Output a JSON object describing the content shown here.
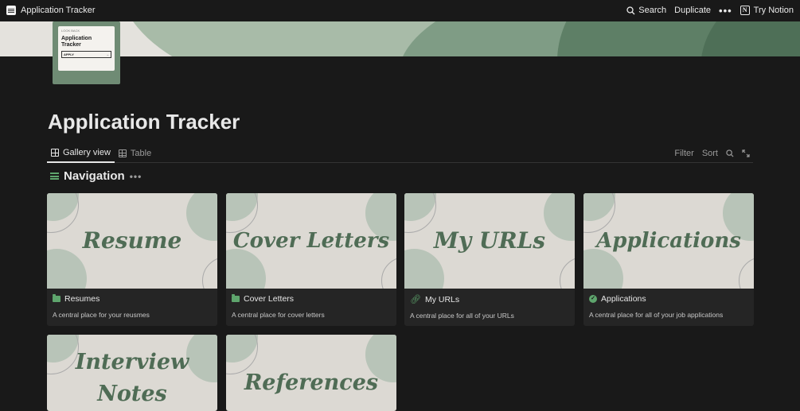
{
  "topbar": {
    "title": "Application Tracker",
    "search": "Search",
    "duplicate": "Duplicate",
    "more": "•••",
    "try_notion": "Try Notion",
    "notion_logo": "N"
  },
  "icon_card": {
    "tiny_text": "LOOK BACK",
    "title_line1": "Application",
    "title_line2": "Tracker",
    "apply": "APPLY",
    "apply_arrow": "→"
  },
  "page": {
    "title": "Application Tracker"
  },
  "tabs": [
    {
      "label": "Gallery view",
      "icon": "gallery-icon",
      "active": true
    },
    {
      "label": "Table",
      "icon": "table-icon",
      "active": false
    }
  ],
  "tools": {
    "filter": "Filter",
    "sort": "Sort"
  },
  "navigation": {
    "label": "Navigation",
    "more": "•••"
  },
  "cards": [
    {
      "cover_text": "Resume",
      "name": "Resumes",
      "icon": "folder-icon",
      "desc": "A central place for your reusmes"
    },
    {
      "cover_text": "Cover Letters",
      "name": "Cover Letters",
      "icon": "folder-icon",
      "desc": "A central place for cover letters"
    },
    {
      "cover_text": "My URLs",
      "name": "My URLs",
      "icon": "link-icon",
      "desc": "A central place for all of your URLs"
    },
    {
      "cover_text": "Applications",
      "name": "Applications",
      "icon": "check-circle-icon",
      "desc": "A central place for all of your job applications"
    },
    {
      "cover_text_line1": "Interview",
      "cover_text_line2": "Notes"
    },
    {
      "cover_text": "References"
    }
  ],
  "colors": {
    "accent": "#5ea56d",
    "background": "#191919",
    "card": "#252525",
    "cover_text": "#4f6c55"
  }
}
